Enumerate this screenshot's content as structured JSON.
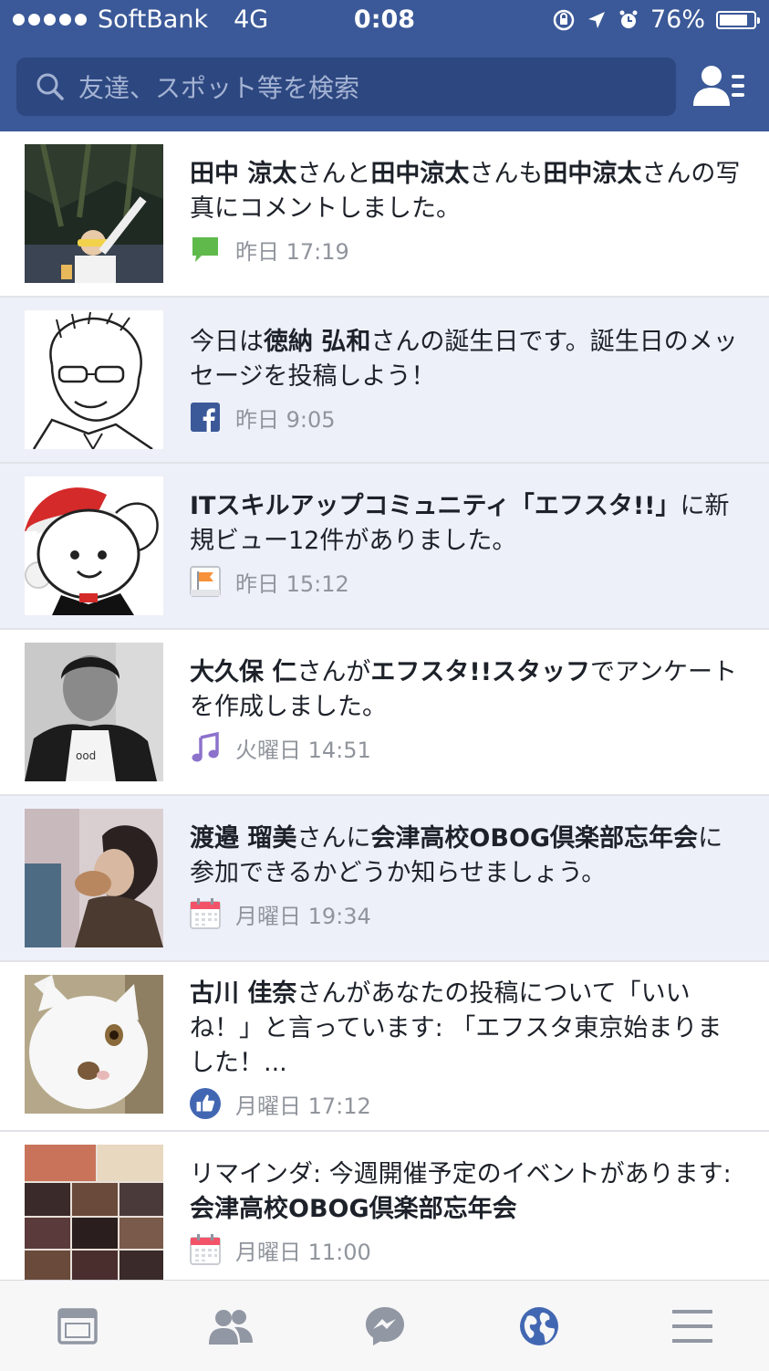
{
  "status_bar": {
    "carrier": "SoftBank",
    "network": "4G",
    "time": "0:08",
    "battery": "76%",
    "battery_level": 0.76
  },
  "search": {
    "placeholder": "友達、スポット等を検索",
    "icon": "search-icon"
  },
  "header": {
    "friend_requests_icon": "friend-requests-icon"
  },
  "colors": {
    "brand": "#3b5998",
    "unread_bg": "#edf0f8",
    "timestamp": "#90949c",
    "like_blue": "#4267b2"
  },
  "notifications": [
    {
      "parts": [
        {
          "t": "田中 涼太",
          "b": true
        },
        {
          "t": "さんと"
        },
        {
          "t": "田中涼太",
          "b": true
        },
        {
          "t": "さんも"
        },
        {
          "t": "田中涼太",
          "b": true
        },
        {
          "t": "さんの写真にコメントしました。"
        }
      ],
      "time": "昨日 17:19",
      "icon": "comment-icon",
      "unread": false
    },
    {
      "parts": [
        {
          "t": "今日は"
        },
        {
          "t": "徳納 弘和",
          "b": true
        },
        {
          "t": "さんの誕生日です。誕生日のメッセージを投稿しよう！"
        }
      ],
      "time": "昨日 9:05",
      "icon": "facebook-icon",
      "unread": true
    },
    {
      "parts": [
        {
          "t": "ITスキルアップコミュニティ「エフスタ!!」",
          "b": true
        },
        {
          "t": "に新規ビュー12件がありました。"
        }
      ],
      "time": "昨日 15:12",
      "icon": "page-flag-icon",
      "unread": true
    },
    {
      "parts": [
        {
          "t": "大久保 仁",
          "b": true
        },
        {
          "t": "さんが"
        },
        {
          "t": "エフスタ!!スタッフ",
          "b": true
        },
        {
          "t": "でアンケートを作成しました。"
        }
      ],
      "time": "火曜日 14:51",
      "icon": "music-note-icon",
      "unread": false
    },
    {
      "parts": [
        {
          "t": "渡邉 瑠美",
          "b": true
        },
        {
          "t": "さんに"
        },
        {
          "t": "会津高校OBOG倶楽部忘年会",
          "b": true
        },
        {
          "t": "に参加できるかどうか知らせましょう。"
        }
      ],
      "time": "月曜日 19:34",
      "icon": "calendar-icon",
      "unread": true
    },
    {
      "parts": [
        {
          "t": "古川 佳奈",
          "b": true
        },
        {
          "t": "さんがあなたの投稿について「いいね！」と言っています: 「エフスタ東京始まりました！..."
        }
      ],
      "time": "月曜日 17:12",
      "icon": "like-icon",
      "unread": false
    },
    {
      "parts": [
        {
          "t": "リマインダ: 今週開催予定のイベントがあります: "
        },
        {
          "t": "会津高校OBOG倶楽部忘年会",
          "b": true
        }
      ],
      "time": "月曜日 11:00",
      "icon": "calendar-icon",
      "unread": false
    }
  ],
  "tabbar": {
    "tabs": [
      "news-feed-icon",
      "friends-icon",
      "messenger-icon",
      "notifications-globe-icon",
      "menu-icon"
    ],
    "active": "notifications-globe-icon"
  }
}
